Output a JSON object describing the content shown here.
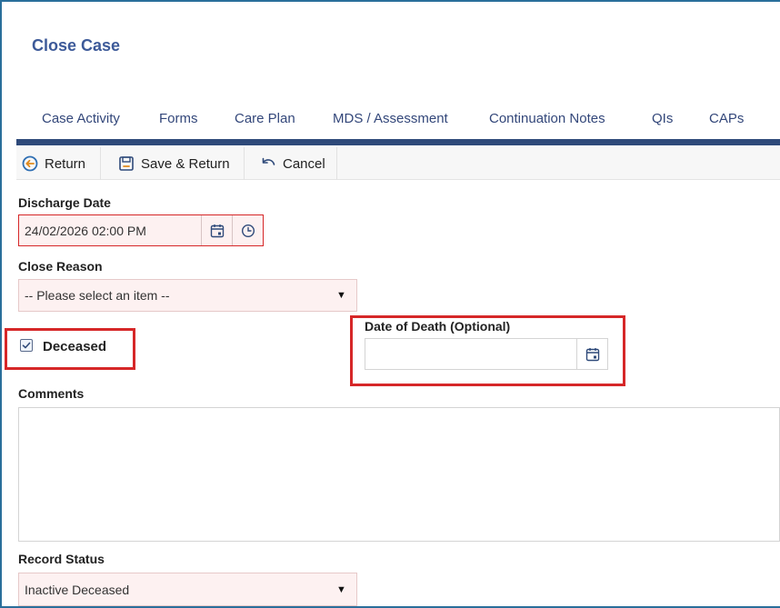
{
  "page": {
    "title": "Close Case"
  },
  "tabs": [
    {
      "label": "Case Activity"
    },
    {
      "label": "Forms"
    },
    {
      "label": "Care Plan"
    },
    {
      "label": "MDS / Assessment"
    },
    {
      "label": "Continuation Notes"
    },
    {
      "label": "QIs"
    },
    {
      "label": "CAPs"
    }
  ],
  "toolbar": {
    "return_label": "Return",
    "save_return_label": "Save & Return",
    "cancel_label": "Cancel"
  },
  "form": {
    "discharge_date": {
      "label": "Discharge Date",
      "value": "24/02/2026 02:00 PM"
    },
    "close_reason": {
      "label": "Close Reason",
      "value": "-- Please select an item --"
    },
    "deceased": {
      "label": "Deceased",
      "checked": true
    },
    "date_of_death": {
      "label": "Date of Death (Optional)",
      "value": ""
    },
    "comments": {
      "label": "Comments",
      "value": ""
    },
    "record_status": {
      "label": "Record Status",
      "value": "Inactive Deceased"
    }
  },
  "colors": {
    "accent": "#3d5a99",
    "tab_bar": "#2f4a7a",
    "required_field_bg": "#fdf1f1",
    "highlight_box": "#d62728",
    "frame_border": "#2a6f9b"
  },
  "icons": [
    "return-arrow-icon",
    "save-icon",
    "undo-icon",
    "calendar-icon",
    "clock-icon",
    "checkbox-checked-icon",
    "dropdown-arrow-icon"
  ]
}
